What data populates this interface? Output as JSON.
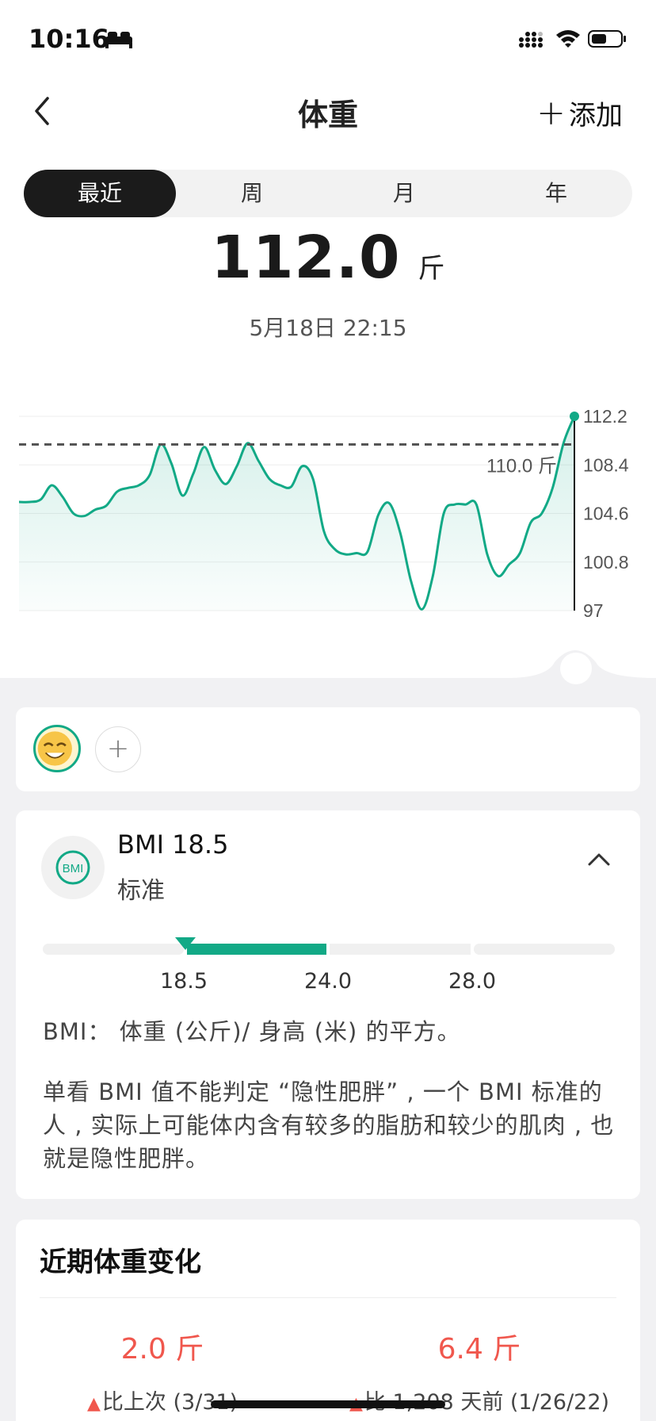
{
  "status_bar": {
    "time": "10:16"
  },
  "nav": {
    "title": "体重",
    "add_label": "添加"
  },
  "tabs": [
    {
      "label": "最近",
      "active": true
    },
    {
      "label": "周",
      "active": false
    },
    {
      "label": "月",
      "active": false
    },
    {
      "label": "年",
      "active": false
    }
  ],
  "summary": {
    "value": "112.0",
    "unit": "斤",
    "date": "5月18日 22:15"
  },
  "chart_data": {
    "type": "line",
    "y_ticks": [
      "112.2",
      "108.4",
      "104.6",
      "100.8",
      "97"
    ],
    "ylim": [
      97,
      112.2
    ],
    "target_label": "110.0 斤",
    "target_value": 110.0,
    "points": [
      105.5,
      105.5,
      105.7,
      106.8,
      105.9,
      104.6,
      104.4,
      104.9,
      105.2,
      106.3,
      106.6,
      106.8,
      107.6,
      110.0,
      108.5,
      106.0,
      107.7,
      109.8,
      108.0,
      106.9,
      108.3,
      110.1,
      108.7,
      107.3,
      106.8,
      106.7,
      108.3,
      107.3,
      103.2,
      101.8,
      101.4,
      101.5,
      101.6,
      104.5,
      105.4,
      103.1,
      99.3,
      97.1,
      99.7,
      104.6,
      105.3,
      105.3,
      105.3,
      101.4,
      99.7,
      100.6,
      101.5,
      103.9,
      104.6,
      106.6,
      110.1,
      112.2
    ]
  },
  "users": {
    "add_symbol": "+"
  },
  "bmi": {
    "icon_text": "BMI",
    "title": "BMI 18.5",
    "status": "标准",
    "value": 18.5,
    "ticks": [
      "18.5",
      "24.0",
      "28.0"
    ],
    "definition": "BMI： 体重 (公斤)/ 身高 (米) 的平方。",
    "description": "单看 BMI 值不能判定 “隐性肥胖” , 一个 BMI 标准的人 , 实际上可能体内含有较多的脂肪和较少的肌肉 , 也就是隐性肥胖。"
  },
  "recent_change": {
    "title": "近期体重变化",
    "items": [
      {
        "value": "2.0 斤",
        "label": "比上次 (3/31)"
      },
      {
        "value": "6.4 斤",
        "label": "比 1,208 天前 (1/26/22)"
      }
    ]
  },
  "colors": {
    "accent": "#12a986",
    "up": "#f0574d"
  }
}
